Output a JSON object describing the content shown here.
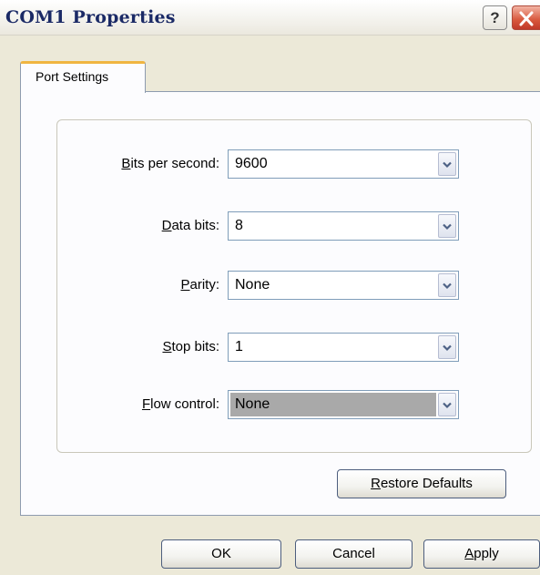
{
  "window": {
    "title": "COM1 Properties",
    "help_label": "?"
  },
  "tabs": [
    {
      "label": "Port Settings",
      "active": true
    }
  ],
  "fields": {
    "bits_per_second": {
      "label_mnemonic": "B",
      "label_rest": "its per second:",
      "value": "9600"
    },
    "data_bits": {
      "label_mnemonic": "D",
      "label_rest": "ata bits:",
      "value": "8"
    },
    "parity": {
      "label_mnemonic": "P",
      "label_rest": "arity:",
      "value": "None"
    },
    "stop_bits": {
      "label_mnemonic": "S",
      "label_rest": "top bits:",
      "value": "1"
    },
    "flow_control": {
      "label_mnemonic": "F",
      "label_rest": "low control:",
      "value": "None"
    }
  },
  "buttons": {
    "restore_mnemonic": "R",
    "restore_rest": "estore Defaults",
    "ok_label": "OK",
    "cancel_label": "Cancel",
    "apply_mnemonic": "A",
    "apply_rest": "pply"
  },
  "icons": {
    "help": "help-icon",
    "close": "close-icon",
    "dropdown": "chevron-down-icon"
  },
  "colors": {
    "title_text": "#1b2a66",
    "close_button": "#d8573c",
    "tab_highlight": "#f0b541",
    "selected_field": "#a9a9a9",
    "dialog_background": "#ece9d8"
  }
}
